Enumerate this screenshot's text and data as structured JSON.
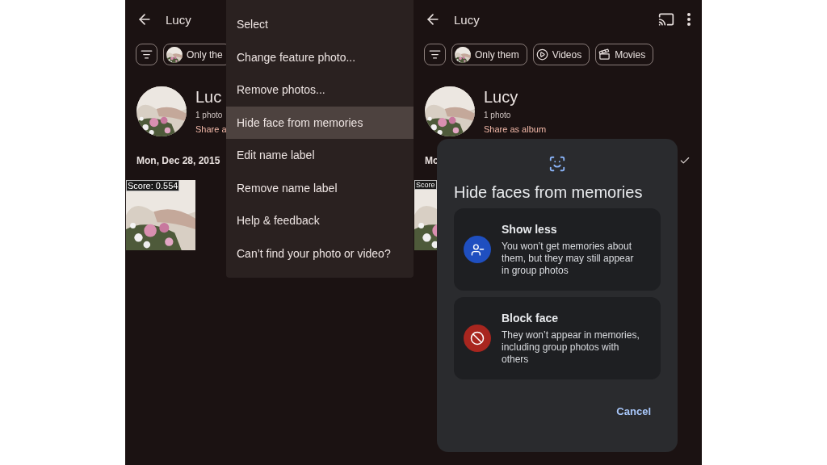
{
  "screens": [
    {
      "header": {
        "title": "Lucy"
      },
      "chips": [
        {
          "kind": "filter"
        },
        {
          "kind": "person",
          "label": "Only the"
        }
      ],
      "profile": {
        "name": "Luc",
        "count": "1 photo",
        "link": "Share a"
      },
      "date": "Mon, Dec 28, 2015",
      "photo": {
        "score": "Score: 0.554"
      },
      "overlay": {
        "kind": "menu",
        "items": [
          {
            "label": "Select",
            "selected": false
          },
          {
            "label": "Change feature photo...",
            "selected": false
          },
          {
            "label": "Remove photos...",
            "selected": false
          },
          {
            "label": "Hide face from memories",
            "selected": true
          },
          {
            "label": "Edit name label",
            "selected": false
          },
          {
            "label": "Remove name label",
            "selected": false
          },
          {
            "label": "Help & feedback",
            "selected": false
          },
          {
            "label": "Can’t find your photo or video?",
            "selected": false
          }
        ]
      }
    },
    {
      "header": {
        "title": "Lucy",
        "actions": [
          {
            "kind": "cast"
          },
          {
            "kind": "more"
          }
        ]
      },
      "chips": [
        {
          "kind": "filter"
        },
        {
          "kind": "person",
          "label": "Only them"
        },
        {
          "kind": "videos",
          "label": "Videos"
        },
        {
          "kind": "movies",
          "label": "Movies"
        }
      ],
      "profile": {
        "name": "Lucy",
        "count": "1 photo",
        "link": "Share as album"
      },
      "date": "Mo",
      "selected_check": true,
      "photo": {
        "score": "Score"
      },
      "overlay": {
        "kind": "dialog",
        "title": "Hide faces from memories",
        "options": [
          {
            "kind": "show_less",
            "title": "Show less",
            "text": "You won’t get memories about them, but they may still appear in group photos",
            "color": "#1f4fc0"
          },
          {
            "kind": "block",
            "title": "Block face",
            "text": "They won’t appear in memories, including group photos with others",
            "color": "#a8261f"
          }
        ],
        "cancel": "Cancel"
      }
    }
  ]
}
